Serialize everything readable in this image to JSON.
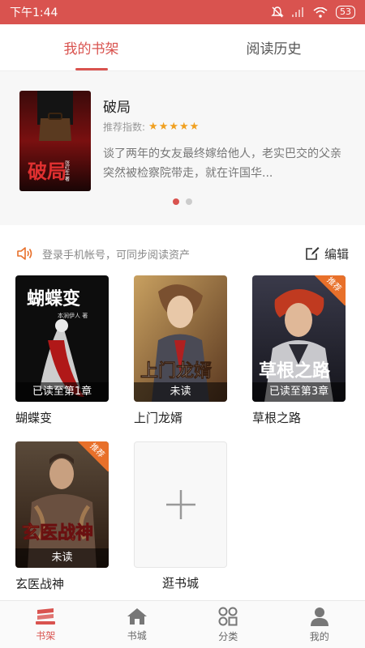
{
  "status_bar": {
    "time": "下午1:44",
    "battery": "53"
  },
  "tabs": [
    {
      "label": "我的书架",
      "active": true
    },
    {
      "label": "阅读历史",
      "active": false
    }
  ],
  "recommend": {
    "title": "破局",
    "rating_label": "推荐指数:",
    "stars": "★★★★★",
    "rating": 5,
    "description": "谈了两年的女友最终嫁给他人，老实巴交的父亲突然被检察院带走，就在许国华...",
    "cover_title": "破局",
    "cover_author": "张红生 著",
    "page_count": 2,
    "current_page": 1
  },
  "notice": {
    "text": "登录手机帐号，可同步阅读资产",
    "edit_label": "编辑"
  },
  "books": [
    {
      "name": "蝴蝶变",
      "progress": "已读至第1章",
      "cover_title": "蝴蝶变",
      "cover_author": "本涧伊人 著",
      "badge": ""
    },
    {
      "name": "上门龙婿",
      "progress": "未读",
      "cover_title": "上门龙婿",
      "badge": ""
    },
    {
      "name": "草根之路",
      "progress": "已读至第3章",
      "cover_title": "草根之路",
      "badge": "推荐"
    },
    {
      "name": "玄医战神",
      "progress": "未读",
      "cover_title": "玄医战神",
      "badge": "推荐"
    }
  ],
  "add_book_label": "逛书城",
  "bottom_nav": [
    {
      "label": "书架",
      "icon": "bookshelf-icon",
      "active": true
    },
    {
      "label": "书城",
      "icon": "store-icon",
      "active": false
    },
    {
      "label": "分类",
      "icon": "category-icon",
      "active": false
    },
    {
      "label": "我的",
      "icon": "profile-icon",
      "active": false
    }
  ],
  "colors": {
    "accent": "#d9534f",
    "star": "#f0a020",
    "badge": "#e8702a"
  }
}
